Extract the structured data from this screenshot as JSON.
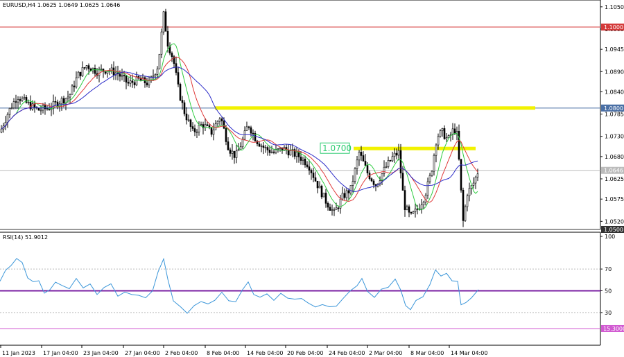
{
  "chart_data": [
    {
      "type": "candlestick",
      "symbol_header": "EURUSD,H4  1.0625 1.0649 1.0625 1.0646",
      "price_ylim": [
        1.05,
        1.106
      ],
      "price_ticks": [
        "1.1050",
        "1.0995",
        "1.0945",
        "1.0890",
        "1.0840",
        "1.0785",
        "1.0730",
        "1.0680",
        "1.0625",
        "1.0575",
        "1.0520"
      ],
      "horizontal_levels": [
        {
          "price": 1.1,
          "label": "1.1000",
          "color": "#d43a3a"
        },
        {
          "price": 1.08,
          "label": "1.0800",
          "color": "#4a6fa5"
        },
        {
          "price": 1.0646,
          "label": "1.0646",
          "color": "#bbbbbb"
        },
        {
          "price": 1.05,
          "label": "1.0500",
          "color": "#333333"
        }
      ],
      "highlight_zones": [
        {
          "price": 1.08,
          "color": "#f2f200"
        },
        {
          "price": 1.07,
          "color": "#f2f200",
          "label": "1.0700",
          "label_color": "#2ecc71"
        }
      ],
      "x_tick_labels": [
        "11 Jan 2023",
        "17 Jan 04:00",
        "23 Jan 04:00",
        "27 Jan 04:00",
        "2 Feb 04:00",
        "8 Feb 04:00",
        "14 Feb 04:00",
        "20 Feb 04:00",
        "24 Feb 04:00",
        "2 Mar 04:00",
        "8 Mar 04:00",
        "14 Mar 04:00"
      ],
      "close_path": [
        [
          0,
          1.074
        ],
        [
          12,
          1.079
        ],
        [
          25,
          1.083
        ],
        [
          40,
          1.081
        ],
        [
          55,
          1.0795
        ],
        [
          70,
          1.08
        ],
        [
          85,
          1.0815
        ],
        [
          100,
          1.083
        ],
        [
          112,
          1.088
        ],
        [
          125,
          1.0905
        ],
        [
          140,
          1.089
        ],
        [
          155,
          1.0895
        ],
        [
          170,
          1.0885
        ],
        [
          185,
          1.086
        ],
        [
          200,
          1.087
        ],
        [
          215,
          1.086
        ],
        [
          228,
          1.0905
        ],
        [
          236,
          1.103
        ],
        [
          242,
          1.096
        ],
        [
          250,
          1.092
        ],
        [
          258,
          1.084
        ],
        [
          266,
          1.079
        ],
        [
          278,
          1.074
        ],
        [
          292,
          1.076
        ],
        [
          305,
          1.074
        ],
        [
          318,
          1.078
        ],
        [
          330,
          1.07
        ],
        [
          340,
          1.068
        ],
        [
          350,
          1.072
        ],
        [
          358,
          1.076
        ],
        [
          370,
          1.072
        ],
        [
          382,
          1.07
        ],
        [
          395,
          1.069
        ],
        [
          408,
          1.07
        ],
        [
          420,
          1.069
        ],
        [
          432,
          1.068
        ],
        [
          445,
          1.066
        ],
        [
          458,
          1.061
        ],
        [
          470,
          1.057
        ],
        [
          482,
          1.054
        ],
        [
          494,
          1.058
        ],
        [
          506,
          1.06
        ],
        [
          518,
          1.069
        ],
        [
          530,
          1.064
        ],
        [
          542,
          1.061
        ],
        [
          555,
          1.065
        ],
        [
          567,
          1.068
        ],
        [
          575,
          1.069
        ],
        [
          583,
          1.056
        ],
        [
          592,
          1.053
        ],
        [
          602,
          1.055
        ],
        [
          612,
          1.058
        ],
        [
          622,
          1.064
        ],
        [
          630,
          1.073
        ],
        [
          638,
          1.074
        ],
        [
          646,
          1.072
        ],
        [
          655,
          1.075
        ],
        [
          660,
          1.073
        ],
        [
          663,
          1.064
        ],
        [
          668,
          1.052
        ],
        [
          674,
          1.059
        ],
        [
          682,
          1.061
        ],
        [
          690,
          1.0646
        ]
      ],
      "moving_averages": [
        {
          "color": "#2ecc40",
          "period": 8
        },
        {
          "color": "#e03a3a",
          "period": 14
        },
        {
          "color": "#2c2cc8",
          "period": 24
        }
      ]
    },
    {
      "type": "line",
      "indicator_label": "RSI(14) 51.9012",
      "ylim": [
        0,
        100
      ],
      "ticks": [
        "100",
        "70",
        "50",
        "30",
        "15.3000"
      ],
      "levels": [
        {
          "value": 70,
          "color": "#bbbbbb"
        },
        {
          "value": 50,
          "color": "#7a1fa2"
        },
        {
          "value": 30,
          "color": "#bbbbbb"
        },
        {
          "value": 15.3,
          "color": "#d15ad1"
        }
      ],
      "series_color": "#3b96d9",
      "values": [
        [
          0,
          60
        ],
        [
          8,
          68
        ],
        [
          16,
          72
        ],
        [
          24,
          80
        ],
        [
          32,
          75
        ],
        [
          40,
          62
        ],
        [
          48,
          58
        ],
        [
          56,
          60
        ],
        [
          64,
          48
        ],
        [
          72,
          52
        ],
        [
          80,
          58
        ],
        [
          90,
          55
        ],
        [
          100,
          52
        ],
        [
          110,
          60
        ],
        [
          120,
          52
        ],
        [
          130,
          55
        ],
        [
          140,
          48
        ],
        [
          150,
          52
        ],
        [
          160,
          55
        ],
        [
          170,
          46
        ],
        [
          180,
          50
        ],
        [
          190,
          48
        ],
        [
          200,
          45
        ],
        [
          210,
          45
        ],
        [
          220,
          50
        ],
        [
          228,
          68
        ],
        [
          236,
          78
        ],
        [
          242,
          60
        ],
        [
          250,
          42
        ],
        [
          260,
          36
        ],
        [
          270,
          30
        ],
        [
          280,
          36
        ],
        [
          290,
          40
        ],
        [
          300,
          38
        ],
        [
          310,
          42
        ],
        [
          320,
          50
        ],
        [
          330,
          40
        ],
        [
          340,
          40
        ],
        [
          350,
          52
        ],
        [
          358,
          58
        ],
        [
          366,
          46
        ],
        [
          375,
          44
        ],
        [
          385,
          48
        ],
        [
          395,
          42
        ],
        [
          405,
          48
        ],
        [
          415,
          44
        ],
        [
          425,
          42
        ],
        [
          435,
          44
        ],
        [
          445,
          40
        ],
        [
          455,
          36
        ],
        [
          465,
          38
        ],
        [
          475,
          34
        ],
        [
          485,
          36
        ],
        [
          495,
          44
        ],
        [
          505,
          50
        ],
        [
          515,
          54
        ],
        [
          522,
          62
        ],
        [
          530,
          48
        ],
        [
          540,
          44
        ],
        [
          550,
          50
        ],
        [
          560,
          52
        ],
        [
          570,
          62
        ],
        [
          578,
          50
        ],
        [
          585,
          36
        ],
        [
          592,
          34
        ],
        [
          600,
          40
        ],
        [
          610,
          44
        ],
        [
          620,
          55
        ],
        [
          628,
          68
        ],
        [
          636,
          64
        ],
        [
          644,
          66
        ],
        [
          652,
          60
        ],
        [
          660,
          60
        ],
        [
          665,
          36
        ],
        [
          672,
          40
        ],
        [
          680,
          44
        ],
        [
          690,
          52
        ]
      ]
    }
  ]
}
